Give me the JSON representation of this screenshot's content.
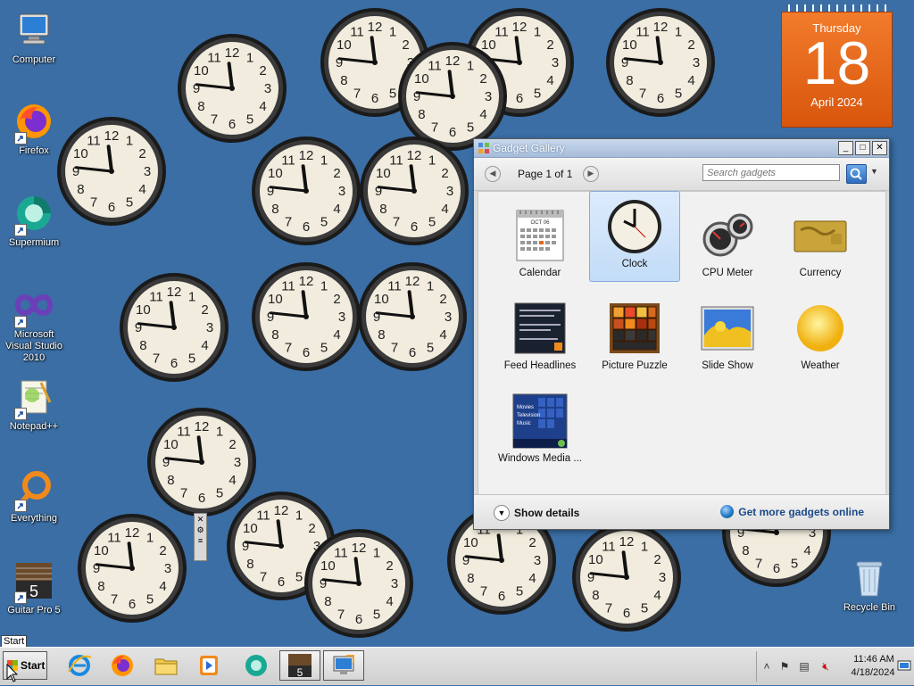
{
  "desktop": {
    "icons": [
      {
        "label": "Computer",
        "icon": "computer-icon"
      },
      {
        "label": "Firefox",
        "icon": "firefox-icon"
      },
      {
        "label": "Supermium",
        "icon": "supermium-icon"
      },
      {
        "label": "Microsoft Visual Studio 2010",
        "icon": "visual-studio-icon"
      },
      {
        "label": "Notepad++",
        "icon": "notepadpp-icon"
      },
      {
        "label": "Everything",
        "icon": "everything-icon"
      },
      {
        "label": "Guitar Pro 5",
        "icon": "guitar-pro-icon"
      },
      {
        "label": "Recycle Bin",
        "icon": "recycle-bin-icon"
      }
    ]
  },
  "calendar_gadget": {
    "weekday": "Thursday",
    "day": "18",
    "month_year": "April 2024",
    "color": "#e8661c"
  },
  "clock_gadgets": {
    "count": 18,
    "time_shown": "11:46"
  },
  "gallery": {
    "title": "Gadget Gallery",
    "page_label": "Page 1 of 1",
    "search_placeholder": "Search gadgets",
    "items": [
      {
        "label": "Calendar",
        "icon": "calendar-icon",
        "selected": false
      },
      {
        "label": "Clock",
        "icon": "clock-icon",
        "selected": true
      },
      {
        "label": "CPU Meter",
        "icon": "cpu-meter-icon",
        "selected": false
      },
      {
        "label": "Currency",
        "icon": "currency-icon",
        "selected": false
      },
      {
        "label": "Feed Headlines",
        "icon": "feed-headlines-icon",
        "selected": false
      },
      {
        "label": "Picture Puzzle",
        "icon": "picture-puzzle-icon",
        "selected": false
      },
      {
        "label": "Slide Show",
        "icon": "slide-show-icon",
        "selected": false
      },
      {
        "label": "Weather",
        "icon": "weather-icon",
        "selected": false
      },
      {
        "label": "Windows Media ...",
        "icon": "windows-media-center-icon",
        "selected": false
      }
    ],
    "show_details": "Show details",
    "get_more": "Get more gadgets online",
    "calendar_thumb_month": "OCT 06",
    "media_thumb_lines": [
      "Movies",
      "Television",
      "Music"
    ]
  },
  "taskbar": {
    "start_label": "Start",
    "start_tooltip": "Start",
    "pinned": [
      {
        "name": "Internet Explorer",
        "icon": "internet-explorer-icon",
        "active": false
      },
      {
        "name": "Firefox",
        "icon": "firefox-icon",
        "active": false
      },
      {
        "name": "Windows Explorer",
        "icon": "folder-icon",
        "active": false
      },
      {
        "name": "Windows Media Player",
        "icon": "media-player-icon",
        "active": false
      },
      {
        "name": "Supermium",
        "icon": "supermium-icon",
        "active": false
      },
      {
        "name": "Guitar Pro 5",
        "icon": "guitar-pro-icon",
        "active": true
      },
      {
        "name": "Remote Desktop",
        "icon": "remote-desktop-icon",
        "active": true
      }
    ],
    "tray": {
      "time": "11:46 AM",
      "date": "4/18/2024"
    }
  }
}
